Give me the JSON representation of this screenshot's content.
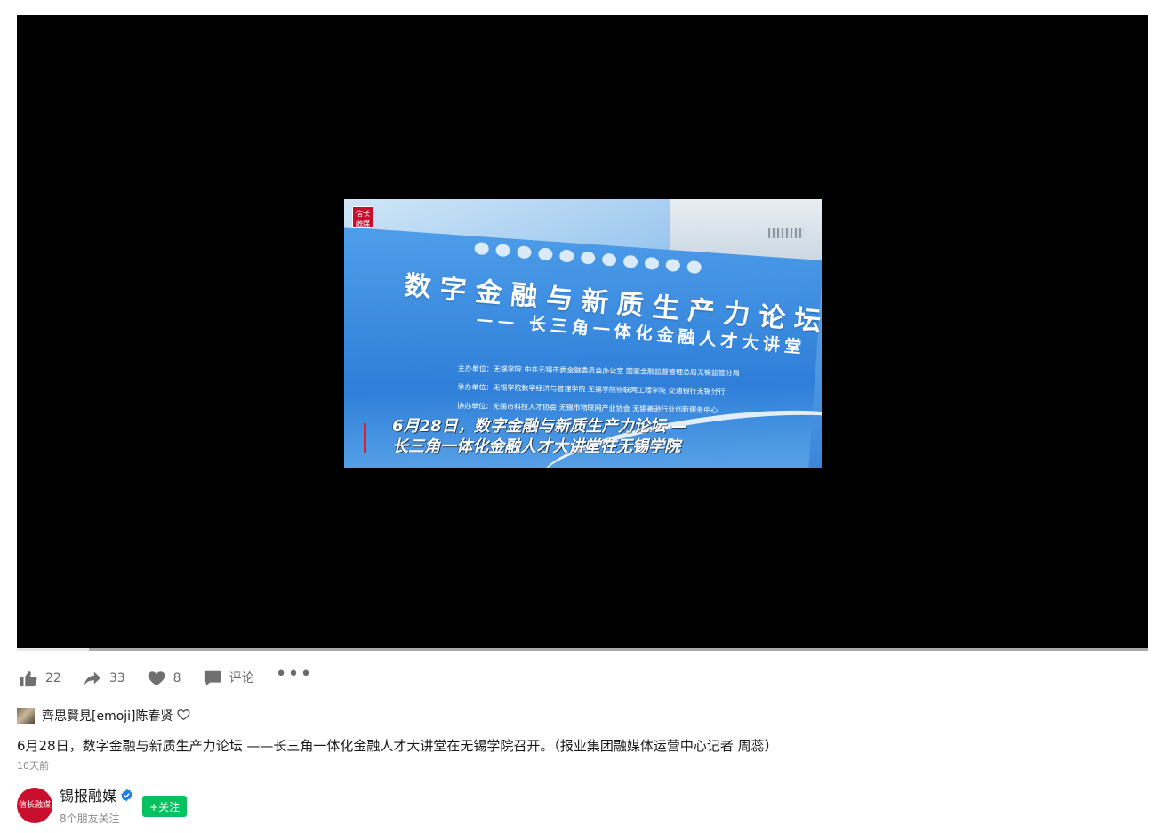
{
  "video": {
    "progress": 0.064,
    "frame_logo": "信长融媒",
    "headline": "数字金融与新质生产力论坛",
    "subhead": "—— 长三角一体化金融人才大讲堂",
    "org_line_1": "主办单位：无锡学院  中共无锡市委金融委员会办公室  国家金融监督管理总局无锡监管分局",
    "org_line_2": "承办单位：无锡学院数字经济与管理学院  无锡学院物联网工程学院  交通银行无锡分行",
    "org_line_3": "协办单位：无锡市科技人才协会  无锡市物联网产业协会  无锡善逊行业创新服务中心",
    "caption_line_1": "6月28日，数字金融与新质生产力论坛 —",
    "caption_line_2": "长三角一体化金融人才大讲堂在无锡学院"
  },
  "actions": {
    "like_count": "22",
    "share_count": "33",
    "favorite_count": "8",
    "comment_label": "评论",
    "more_label": "•••"
  },
  "liked_by": {
    "text": "齊思賢見[emoji]陈春贤"
  },
  "post": {
    "description": "6月28日，数字金融与新质生产力论坛 ——长三角一体化金融人才大讲堂在无锡学院召开。（报业集团融媒体运营中心记者 周蕊）",
    "time": "10天前"
  },
  "author": {
    "avatar_text": "信长融媒",
    "name": "锡报融媒",
    "follow_label": "+关注",
    "friends_text": "8个朋友关注"
  },
  "colors": {
    "accent_green": "#07c160",
    "brand_red": "#c8102e",
    "verified_blue": "#1b7fe6"
  }
}
